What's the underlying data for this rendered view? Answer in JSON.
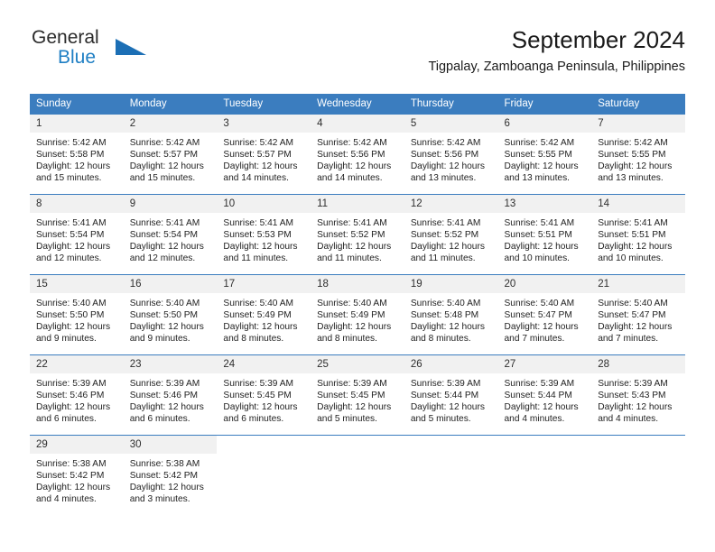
{
  "brand": {
    "name_part1": "General",
    "name_part2": "Blue",
    "triangle_icon": "triangle-icon",
    "colors": {
      "blue": "#1f7fc4",
      "dark": "#2b2b2b",
      "header_blue": "#3b7dbf",
      "daynum_bg": "#f1f1f1"
    }
  },
  "header": {
    "title": "September 2024",
    "subtitle": "Tigpalay, Zamboanga Peninsula, Philippines"
  },
  "calendar": {
    "weekday_headers": [
      "Sunday",
      "Monday",
      "Tuesday",
      "Wednesday",
      "Thursday",
      "Friday",
      "Saturday"
    ],
    "weeks": [
      [
        {
          "day": "1",
          "sunrise": "Sunrise: 5:42 AM",
          "sunset": "Sunset: 5:58 PM",
          "daylight_line1": "Daylight: 12 hours",
          "daylight_line2": "and 15 minutes."
        },
        {
          "day": "2",
          "sunrise": "Sunrise: 5:42 AM",
          "sunset": "Sunset: 5:57 PM",
          "daylight_line1": "Daylight: 12 hours",
          "daylight_line2": "and 15 minutes."
        },
        {
          "day": "3",
          "sunrise": "Sunrise: 5:42 AM",
          "sunset": "Sunset: 5:57 PM",
          "daylight_line1": "Daylight: 12 hours",
          "daylight_line2": "and 14 minutes."
        },
        {
          "day": "4",
          "sunrise": "Sunrise: 5:42 AM",
          "sunset": "Sunset: 5:56 PM",
          "daylight_line1": "Daylight: 12 hours",
          "daylight_line2": "and 14 minutes."
        },
        {
          "day": "5",
          "sunrise": "Sunrise: 5:42 AM",
          "sunset": "Sunset: 5:56 PM",
          "daylight_line1": "Daylight: 12 hours",
          "daylight_line2": "and 13 minutes."
        },
        {
          "day": "6",
          "sunrise": "Sunrise: 5:42 AM",
          "sunset": "Sunset: 5:55 PM",
          "daylight_line1": "Daylight: 12 hours",
          "daylight_line2": "and 13 minutes."
        },
        {
          "day": "7",
          "sunrise": "Sunrise: 5:42 AM",
          "sunset": "Sunset: 5:55 PM",
          "daylight_line1": "Daylight: 12 hours",
          "daylight_line2": "and 13 minutes."
        }
      ],
      [
        {
          "day": "8",
          "sunrise": "Sunrise: 5:41 AM",
          "sunset": "Sunset: 5:54 PM",
          "daylight_line1": "Daylight: 12 hours",
          "daylight_line2": "and 12 minutes."
        },
        {
          "day": "9",
          "sunrise": "Sunrise: 5:41 AM",
          "sunset": "Sunset: 5:54 PM",
          "daylight_line1": "Daylight: 12 hours",
          "daylight_line2": "and 12 minutes."
        },
        {
          "day": "10",
          "sunrise": "Sunrise: 5:41 AM",
          "sunset": "Sunset: 5:53 PM",
          "daylight_line1": "Daylight: 12 hours",
          "daylight_line2": "and 11 minutes."
        },
        {
          "day": "11",
          "sunrise": "Sunrise: 5:41 AM",
          "sunset": "Sunset: 5:52 PM",
          "daylight_line1": "Daylight: 12 hours",
          "daylight_line2": "and 11 minutes."
        },
        {
          "day": "12",
          "sunrise": "Sunrise: 5:41 AM",
          "sunset": "Sunset: 5:52 PM",
          "daylight_line1": "Daylight: 12 hours",
          "daylight_line2": "and 11 minutes."
        },
        {
          "day": "13",
          "sunrise": "Sunrise: 5:41 AM",
          "sunset": "Sunset: 5:51 PM",
          "daylight_line1": "Daylight: 12 hours",
          "daylight_line2": "and 10 minutes."
        },
        {
          "day": "14",
          "sunrise": "Sunrise: 5:41 AM",
          "sunset": "Sunset: 5:51 PM",
          "daylight_line1": "Daylight: 12 hours",
          "daylight_line2": "and 10 minutes."
        }
      ],
      [
        {
          "day": "15",
          "sunrise": "Sunrise: 5:40 AM",
          "sunset": "Sunset: 5:50 PM",
          "daylight_line1": "Daylight: 12 hours",
          "daylight_line2": "and 9 minutes."
        },
        {
          "day": "16",
          "sunrise": "Sunrise: 5:40 AM",
          "sunset": "Sunset: 5:50 PM",
          "daylight_line1": "Daylight: 12 hours",
          "daylight_line2": "and 9 minutes."
        },
        {
          "day": "17",
          "sunrise": "Sunrise: 5:40 AM",
          "sunset": "Sunset: 5:49 PM",
          "daylight_line1": "Daylight: 12 hours",
          "daylight_line2": "and 8 minutes."
        },
        {
          "day": "18",
          "sunrise": "Sunrise: 5:40 AM",
          "sunset": "Sunset: 5:49 PM",
          "daylight_line1": "Daylight: 12 hours",
          "daylight_line2": "and 8 minutes."
        },
        {
          "day": "19",
          "sunrise": "Sunrise: 5:40 AM",
          "sunset": "Sunset: 5:48 PM",
          "daylight_line1": "Daylight: 12 hours",
          "daylight_line2": "and 8 minutes."
        },
        {
          "day": "20",
          "sunrise": "Sunrise: 5:40 AM",
          "sunset": "Sunset: 5:47 PM",
          "daylight_line1": "Daylight: 12 hours",
          "daylight_line2": "and 7 minutes."
        },
        {
          "day": "21",
          "sunrise": "Sunrise: 5:40 AM",
          "sunset": "Sunset: 5:47 PM",
          "daylight_line1": "Daylight: 12 hours",
          "daylight_line2": "and 7 minutes."
        }
      ],
      [
        {
          "day": "22",
          "sunrise": "Sunrise: 5:39 AM",
          "sunset": "Sunset: 5:46 PM",
          "daylight_line1": "Daylight: 12 hours",
          "daylight_line2": "and 6 minutes."
        },
        {
          "day": "23",
          "sunrise": "Sunrise: 5:39 AM",
          "sunset": "Sunset: 5:46 PM",
          "daylight_line1": "Daylight: 12 hours",
          "daylight_line2": "and 6 minutes."
        },
        {
          "day": "24",
          "sunrise": "Sunrise: 5:39 AM",
          "sunset": "Sunset: 5:45 PM",
          "daylight_line1": "Daylight: 12 hours",
          "daylight_line2": "and 6 minutes."
        },
        {
          "day": "25",
          "sunrise": "Sunrise: 5:39 AM",
          "sunset": "Sunset: 5:45 PM",
          "daylight_line1": "Daylight: 12 hours",
          "daylight_line2": "and 5 minutes."
        },
        {
          "day": "26",
          "sunrise": "Sunrise: 5:39 AM",
          "sunset": "Sunset: 5:44 PM",
          "daylight_line1": "Daylight: 12 hours",
          "daylight_line2": "and 5 minutes."
        },
        {
          "day": "27",
          "sunrise": "Sunrise: 5:39 AM",
          "sunset": "Sunset: 5:44 PM",
          "daylight_line1": "Daylight: 12 hours",
          "daylight_line2": "and 4 minutes."
        },
        {
          "day": "28",
          "sunrise": "Sunrise: 5:39 AM",
          "sunset": "Sunset: 5:43 PM",
          "daylight_line1": "Daylight: 12 hours",
          "daylight_line2": "and 4 minutes."
        }
      ],
      [
        {
          "day": "29",
          "sunrise": "Sunrise: 5:38 AM",
          "sunset": "Sunset: 5:42 PM",
          "daylight_line1": "Daylight: 12 hours",
          "daylight_line2": "and 4 minutes."
        },
        {
          "day": "30",
          "sunrise": "Sunrise: 5:38 AM",
          "sunset": "Sunset: 5:42 PM",
          "daylight_line1": "Daylight: 12 hours",
          "daylight_line2": "and 3 minutes."
        },
        {
          "day": "",
          "sunrise": "",
          "sunset": "",
          "daylight_line1": "",
          "daylight_line2": ""
        },
        {
          "day": "",
          "sunrise": "",
          "sunset": "",
          "daylight_line1": "",
          "daylight_line2": ""
        },
        {
          "day": "",
          "sunrise": "",
          "sunset": "",
          "daylight_line1": "",
          "daylight_line2": ""
        },
        {
          "day": "",
          "sunrise": "",
          "sunset": "",
          "daylight_line1": "",
          "daylight_line2": ""
        },
        {
          "day": "",
          "sunrise": "",
          "sunset": "",
          "daylight_line1": "",
          "daylight_line2": ""
        }
      ]
    ]
  }
}
